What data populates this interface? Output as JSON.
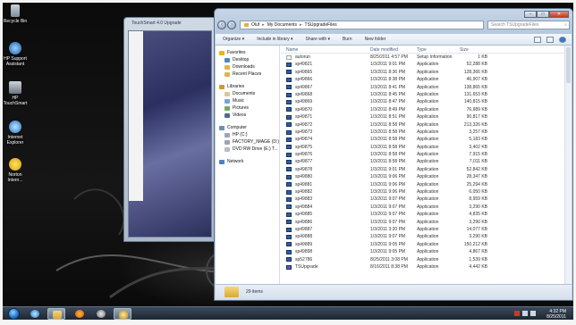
{
  "desktop": {
    "icons": [
      {
        "name": "recycle-bin",
        "line1": "Recycle Bin",
        "line2": ""
      },
      {
        "name": "hp-support-assistant",
        "line1": "HP Support",
        "line2": "Assistant"
      },
      {
        "name": "hp-touchsmart",
        "line1": "HP",
        "line2": "TouchSmart"
      },
      {
        "name": "internet-explorer",
        "line1": "Internet",
        "line2": "Explorer"
      },
      {
        "name": "norton-internet",
        "line1": "Norton",
        "line2": "Intern..."
      }
    ]
  },
  "back_window": {
    "title": "TouchSmart 4.0 Upgrade"
  },
  "explorer": {
    "caption": {
      "minimize": "–",
      "maximize": "□",
      "close": "✕"
    },
    "address": {
      "crumbs": [
        "Oluf",
        "My Documents",
        "TSUpgradeFiles"
      ],
      "search_placeholder": "Search TSUpgradeFiles"
    },
    "toolbar": {
      "items": [
        "Organize ▾",
        "Include in library ▾",
        "Share with ▾",
        "Burn",
        "New folder"
      ]
    },
    "nav": {
      "favorites_label": "Favorites",
      "favorites": [
        "Desktop",
        "Downloads",
        "Recent Places"
      ],
      "libraries_label": "Libraries",
      "libraries": [
        "Documents",
        "Music",
        "Pictures",
        "Videos"
      ],
      "computer_label": "Computer",
      "computer": [
        "HP (C:)",
        "FACTORY_IMAGE (D:)",
        "DVD RW Drive (E:) T..."
      ],
      "network_label": "Network"
    },
    "columns": {
      "name": "Name",
      "date": "Date modified",
      "type": "Type",
      "size": "Size"
    },
    "files": [
      {
        "name": "autorun",
        "date": "8/25/2011 4:57 PM",
        "type": "Setup Information",
        "size": "1 KB",
        "icon": "setup"
      },
      {
        "name": "sp49821",
        "date": "1/3/2011 9:01 PM",
        "type": "Application",
        "size": "52,288 KB",
        "icon": "app"
      },
      {
        "name": "sp49865",
        "date": "1/3/2011 8:36 PM",
        "type": "Application",
        "size": "128,366 KB",
        "icon": "app"
      },
      {
        "name": "sp49866",
        "date": "1/3/2011 8:38 PM",
        "type": "Application",
        "size": "46,907 KB",
        "icon": "app"
      },
      {
        "name": "sp49867",
        "date": "1/3/2011 8:41 PM",
        "type": "Application",
        "size": "138,865 KB",
        "icon": "app"
      },
      {
        "name": "sp49868",
        "date": "1/3/2011 8:45 PM",
        "type": "Application",
        "size": "131,653 KB",
        "icon": "app"
      },
      {
        "name": "sp49869",
        "date": "1/3/2011 8:47 PM",
        "type": "Application",
        "size": "140,815 KB",
        "icon": "app"
      },
      {
        "name": "sp49870",
        "date": "1/3/2011 8:49 PM",
        "type": "Application",
        "size": "76,989 KB",
        "icon": "app"
      },
      {
        "name": "sp49871",
        "date": "1/3/2011 8:51 PM",
        "type": "Application",
        "size": "90,817 KB",
        "icon": "app"
      },
      {
        "name": "sp49872",
        "date": "1/3/2011 8:58 PM",
        "type": "Application",
        "size": "213,326 KB",
        "icon": "app"
      },
      {
        "name": "sp49873",
        "date": "1/3/2011 8:58 PM",
        "type": "Application",
        "size": "3,257 KB",
        "icon": "app"
      },
      {
        "name": "sp49874",
        "date": "1/3/2011 8:58 PM",
        "type": "Application",
        "size": "5,183 KB",
        "icon": "app"
      },
      {
        "name": "sp49875",
        "date": "1/3/2011 8:58 PM",
        "type": "Application",
        "size": "3,402 KB",
        "icon": "app"
      },
      {
        "name": "sp49876",
        "date": "1/3/2011 8:58 PM",
        "type": "Application",
        "size": "7,915 KB",
        "icon": "app"
      },
      {
        "name": "sp49877",
        "date": "1/3/2011 8:58 PM",
        "type": "Application",
        "size": "7,011 KB",
        "icon": "app"
      },
      {
        "name": "sp49878",
        "date": "1/3/2011 9:01 PM",
        "type": "Application",
        "size": "52,842 KB",
        "icon": "app"
      },
      {
        "name": "sp49880",
        "date": "1/3/2011 9:06 PM",
        "type": "Application",
        "size": "28,347 KB",
        "icon": "app"
      },
      {
        "name": "sp49881",
        "date": "1/3/2011 9:06 PM",
        "type": "Application",
        "size": "25,294 KB",
        "icon": "app"
      },
      {
        "name": "sp49882",
        "date": "1/3/2011 9:06 PM",
        "type": "Application",
        "size": "6,050 KB",
        "icon": "app"
      },
      {
        "name": "sp49883",
        "date": "1/3/2011 9:07 PM",
        "type": "Application",
        "size": "8,959 KB",
        "icon": "app"
      },
      {
        "name": "sp49884",
        "date": "1/3/2011 9:07 PM",
        "type": "Application",
        "size": "3,290 KB",
        "icon": "app"
      },
      {
        "name": "sp49885",
        "date": "1/3/2011 9:07 PM",
        "type": "Application",
        "size": "4,835 KB",
        "icon": "app"
      },
      {
        "name": "sp49886",
        "date": "1/3/2011 9:07 PM",
        "type": "Application",
        "size": "3,290 KB",
        "icon": "app"
      },
      {
        "name": "sp49887",
        "date": "1/3/2011 3:20 PM",
        "type": "Application",
        "size": "14,077 KB",
        "icon": "app"
      },
      {
        "name": "sp49888",
        "date": "1/3/2011 9:07 PM",
        "type": "Application",
        "size": "3,290 KB",
        "icon": "app"
      },
      {
        "name": "sp49889",
        "date": "1/3/2011 9:05 PM",
        "type": "Application",
        "size": "150,212 KB",
        "icon": "app"
      },
      {
        "name": "sp49898",
        "date": "1/3/2011 9:05 PM",
        "type": "Application",
        "size": "4,867 KB",
        "icon": "app"
      },
      {
        "name": "sp52786",
        "date": "8/25/2011 3:08 PM",
        "type": "Application",
        "size": "1,539 KB",
        "icon": "app"
      },
      {
        "name": "TSUpgrade",
        "date": "8/16/2011 8:38 PM",
        "type": "Application",
        "size": "4,442 KB",
        "icon": "app2"
      }
    ],
    "status": {
      "count": "29 items"
    }
  },
  "taskbar": {
    "time": "4:32 PM",
    "date": "8/25/2011"
  }
}
